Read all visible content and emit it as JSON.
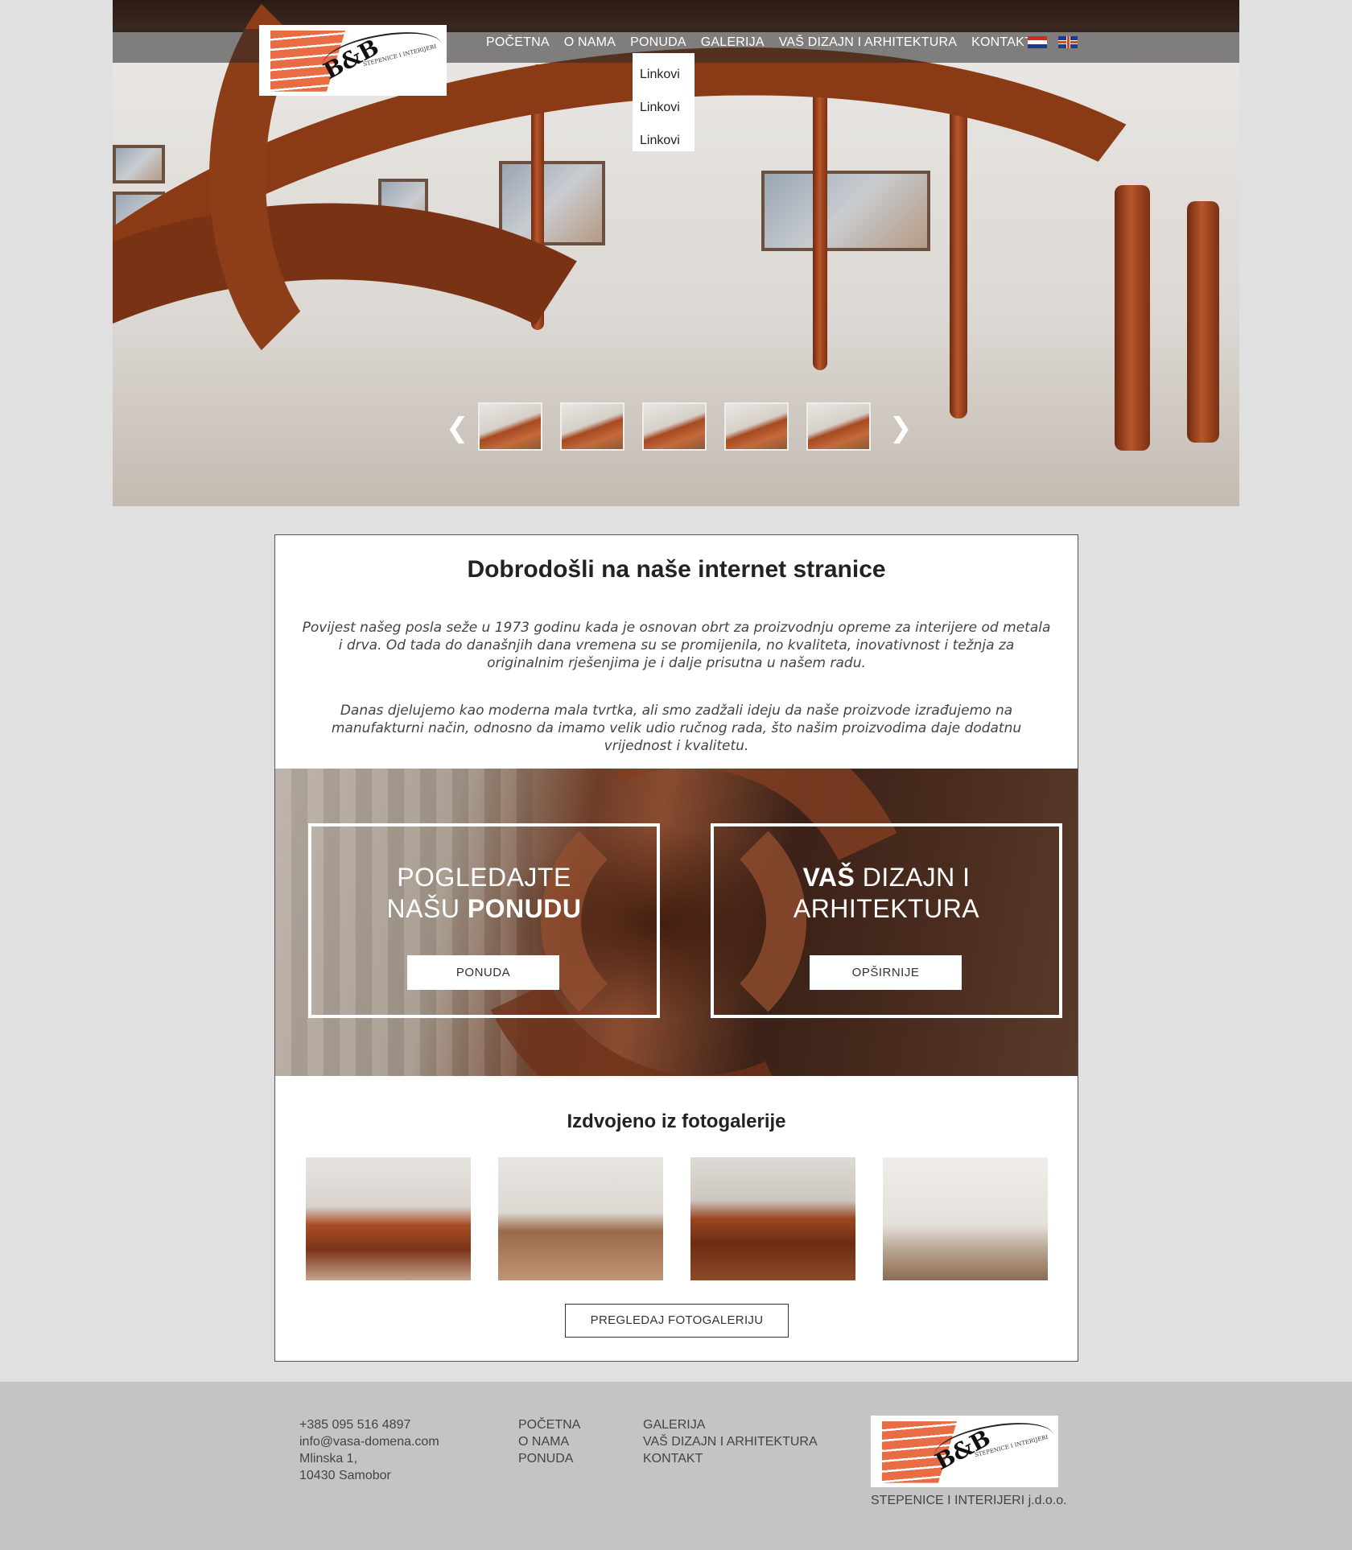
{
  "nav": {
    "items": [
      "POČETNA",
      "O NAMA",
      "PONUDA",
      "GALERIJA",
      "VAŠ DIZAJN I ARHITEKTURA",
      "KONTAKT"
    ],
    "dropdown": [
      "Linkovi",
      "Linkovi",
      "Linkovi"
    ]
  },
  "logo": {
    "mark": "B&B",
    "tagline": "STEPENICE I INTERIJERI"
  },
  "slider": {
    "prev": "❮",
    "next": "❯"
  },
  "welcome": {
    "title": "Dobrodošli na naše internet stranice",
    "para1": "Povijest našeg posla seže u 1973 godinu kada je osnovan obrt za proizvodnju opreme za interijere od metala i drva. Od tada do današnjih dana vremena su se promijenila, no kvaliteta, inovativnost i težnja za originalnim rješenjima je i dalje prisutna u našem radu.",
    "para2": "Danas djelujemo kao moderna mala tvrtka, ali smo zadžali ideju da naše proizvode izrađujemo na manufakturni način, odnosno da imamo velik udio ručnog rada, što našim proizvodima daje dodatnu vrijednost i kvalitetu."
  },
  "promo": {
    "left": {
      "line1": "POGLEDAJTE",
      "line2_pre": "NAŠU ",
      "line2_bold": "PONUDU",
      "button": "PONUDA"
    },
    "right": {
      "line1_bold": "VAŠ",
      "line1_rest": " DIZAJN I",
      "line2": "ARHITEKTURA",
      "button": "OPŠIRNIJE"
    }
  },
  "gallery": {
    "title": "Izdvojeno iz fotogalerije",
    "button": "PREGLEDAJ FOTOGALERIJU"
  },
  "footer": {
    "contact": [
      "+385 095 516 4897",
      "info@vasa-domena.com",
      "Mlinska 1,",
      "10430 Samobor"
    ],
    "links1": [
      "POČETNA",
      "O NAMA",
      "PONUDA"
    ],
    "links2": [
      "GALERIJA",
      "VAŠ DIZAJN I ARHITEKTURA",
      "KONTAKT"
    ],
    "company": "STEPENICE I INTERIJERI j.d.o.o."
  },
  "colors": {
    "accent": "#e86c44",
    "background": "#e0e0e0",
    "footer": "#c4c4c4"
  }
}
